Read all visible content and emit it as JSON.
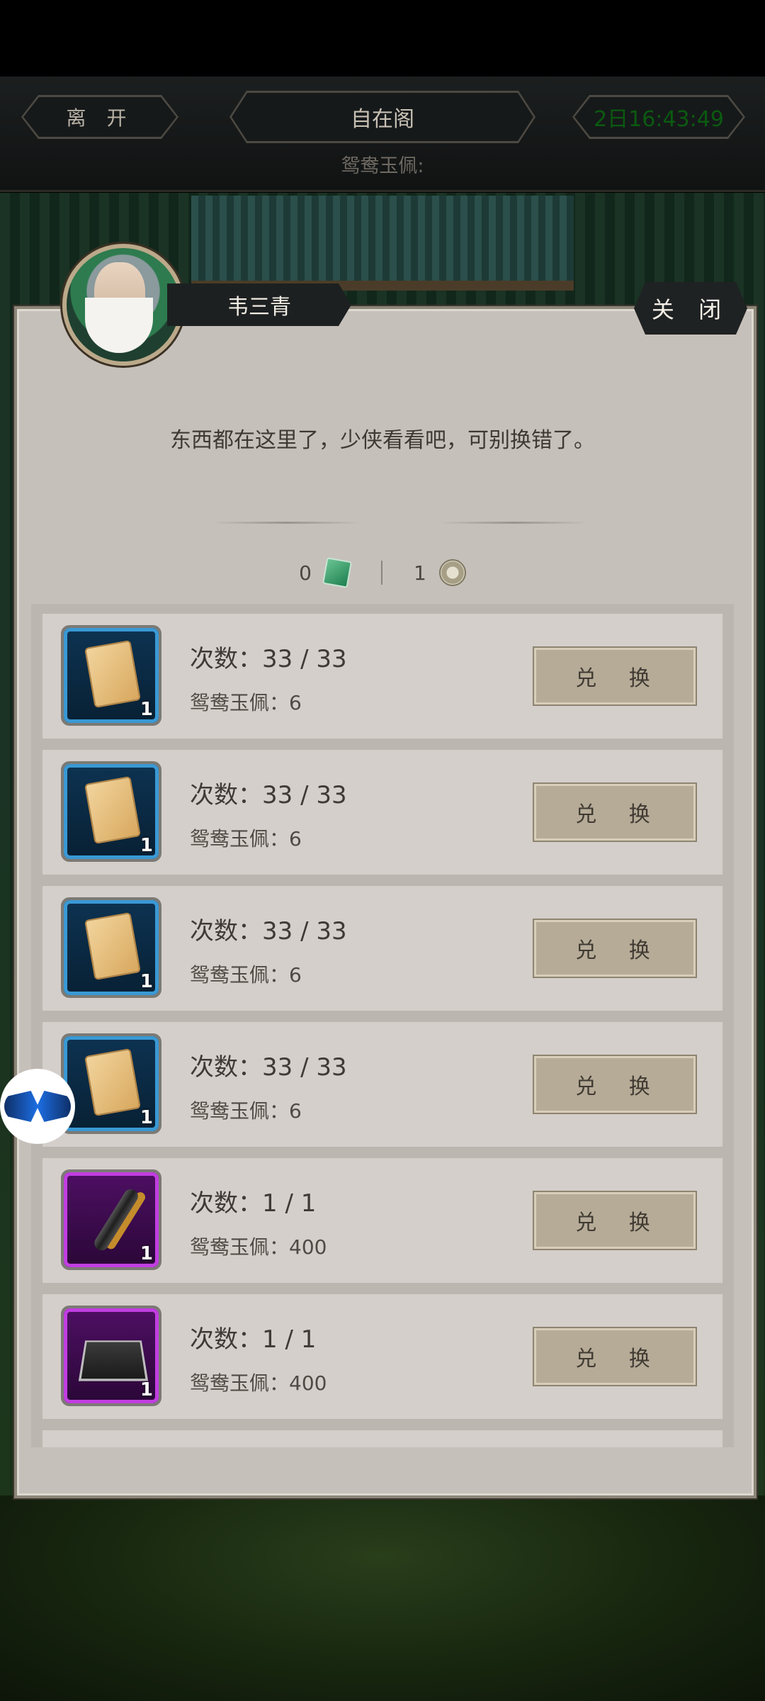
{
  "topbar": {
    "leave_label": "离 开",
    "title": "自在阁",
    "timer": "2日16:43:49",
    "currency_label": "鸳鸯玉佩:"
  },
  "npc": {
    "name": "韦三青",
    "close_label": "关 闭",
    "dialog": "东西都在这里了，少侠看看吧，可别换错了。"
  },
  "balance": {
    "jade_count": "0",
    "coin_count": "1"
  },
  "items": [
    {
      "count": "次数：33 / 33",
      "cost": "鸳鸯玉佩：6",
      "qty": "1",
      "rarity": "blue",
      "icon": "scroll-icon",
      "button": "兑 换"
    },
    {
      "count": "次数：33 / 33",
      "cost": "鸳鸯玉佩：6",
      "qty": "1",
      "rarity": "blue",
      "icon": "scroll-icon",
      "button": "兑 换"
    },
    {
      "count": "次数：33 / 33",
      "cost": "鸳鸯玉佩：6",
      "qty": "1",
      "rarity": "blue",
      "icon": "scroll-icon",
      "button": "兑 换"
    },
    {
      "count": "次数：33 / 33",
      "cost": "鸳鸯玉佩：6",
      "qty": "1",
      "rarity": "blue",
      "icon": "scroll-icon",
      "button": "兑 换"
    },
    {
      "count": "次数：1 / 1",
      "cost": "鸳鸯玉佩：400",
      "qty": "1",
      "rarity": "purple",
      "icon": "flute-icon",
      "button": "兑 换"
    },
    {
      "count": "次数：1 / 1",
      "cost": "鸳鸯玉佩：400",
      "qty": "1",
      "rarity": "purple",
      "icon": "go-board-icon",
      "button": "兑 换"
    }
  ]
}
